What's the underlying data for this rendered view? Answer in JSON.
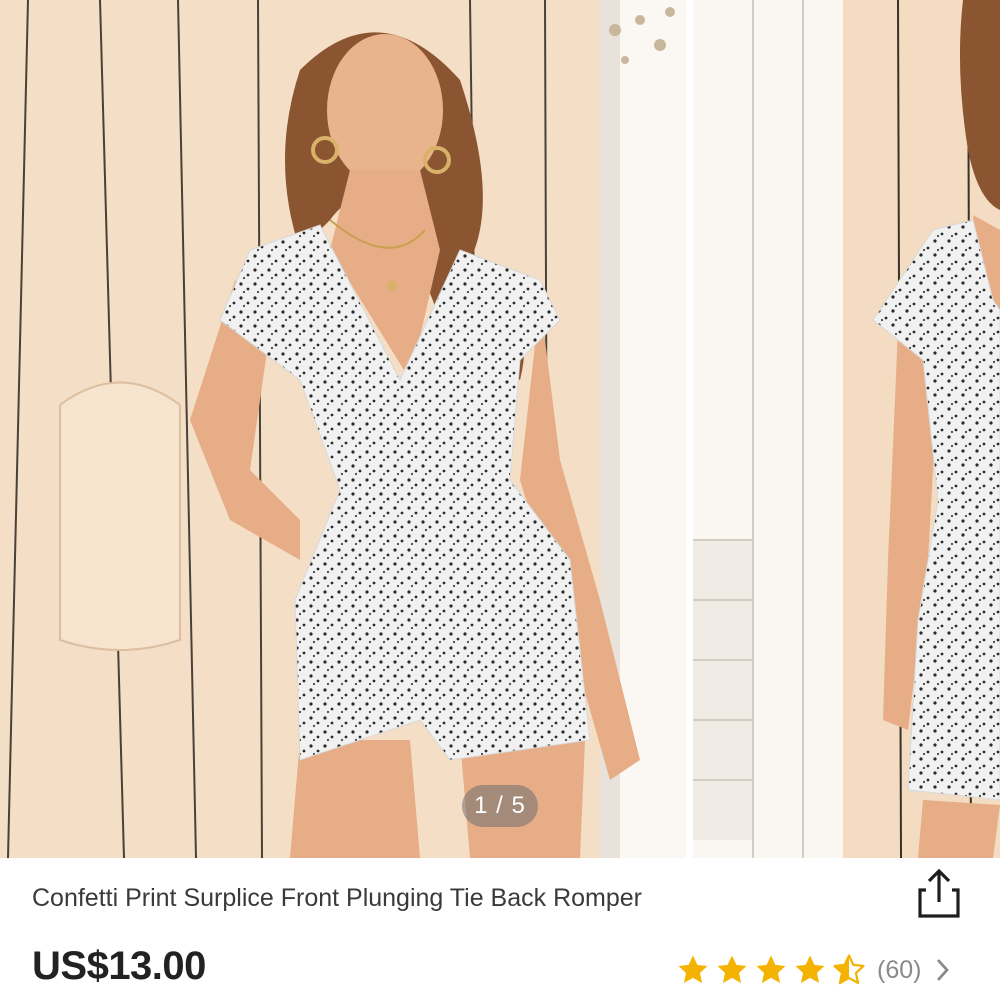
{
  "gallery": {
    "counter": "1 / 5",
    "slides": [
      {
        "subject": "model-front-view"
      },
      {
        "subject": "model-back-view"
      }
    ]
  },
  "product": {
    "title": "Confetti Print Surplice Front Plunging Tie Back Romper",
    "price": "US$13.00",
    "rating": {
      "stars": 4.5,
      "count_label": "(60)"
    }
  },
  "icons": {
    "share": "share-icon",
    "star": "star-icon",
    "chevron": "chevron-right-icon"
  },
  "colors": {
    "star": "#f5b301",
    "price": "#222222",
    "title": "#3a3a3a",
    "counter_bg": "#6e6e6e"
  }
}
